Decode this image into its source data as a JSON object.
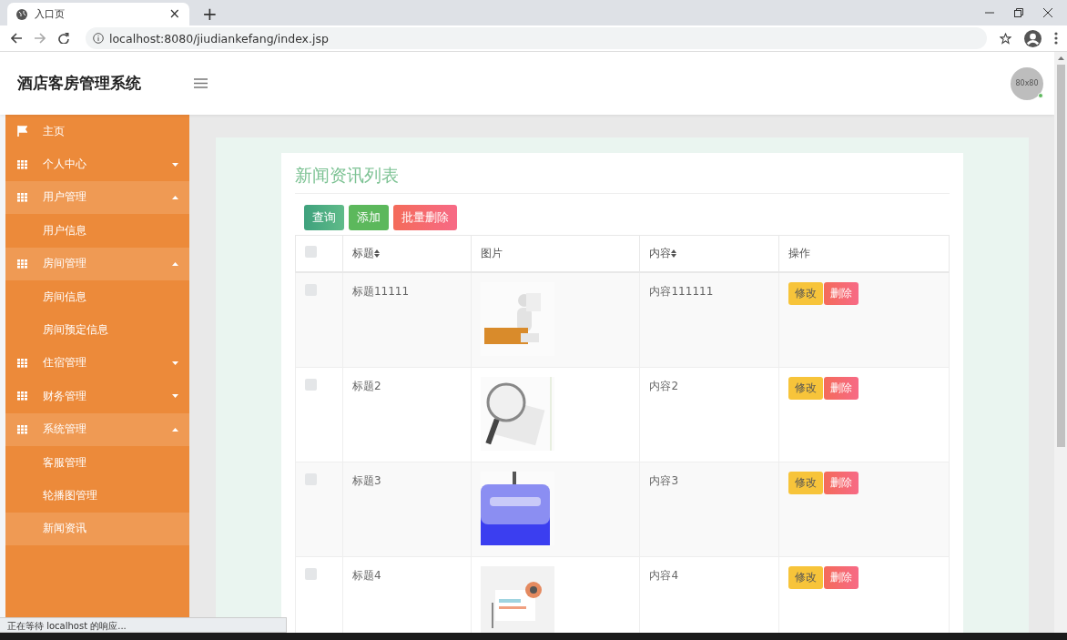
{
  "browser": {
    "tab": {
      "title": "入口页",
      "close": "×"
    },
    "new_tab": "+",
    "url": "localhost:8080/jiudiankefang/index.jsp"
  },
  "header": {
    "title": "酒店客房管理系统",
    "avatar": {
      "text": "80x80",
      "online": true
    }
  },
  "sidebar": {
    "items": [
      {
        "label": "主页",
        "kind": "link",
        "selected": false
      },
      {
        "label": "个人中心",
        "kind": "group",
        "expanded": false
      },
      {
        "label": "用户管理",
        "kind": "group",
        "expanded": true,
        "children": [
          {
            "label": "用户信息",
            "selected": false
          }
        ]
      },
      {
        "label": "房间管理",
        "kind": "group",
        "expanded": true,
        "children": [
          {
            "label": "房间信息",
            "selected": false
          },
          {
            "label": "房间预定信息",
            "selected": false
          }
        ]
      },
      {
        "label": "住宿管理",
        "kind": "group",
        "expanded": false
      },
      {
        "label": "财务管理",
        "kind": "group",
        "expanded": false
      },
      {
        "label": "系统管理",
        "kind": "group",
        "expanded": true,
        "children": [
          {
            "label": "客服管理",
            "selected": false
          },
          {
            "label": "轮播图管理",
            "selected": false
          },
          {
            "label": "新闻资讯",
            "selected": true
          }
        ]
      }
    ]
  },
  "panel": {
    "title": "新闻资讯列表",
    "buttons": [
      {
        "label": "查询",
        "kind": "search"
      },
      {
        "label": "添加",
        "kind": "add"
      },
      {
        "label": "批量删除",
        "kind": "delete"
      }
    ],
    "table": {
      "select_all": {
        "checked": false
      },
      "columns": [
        {
          "label": "标题",
          "sortable": true
        },
        {
          "label": "图片",
          "sortable": false
        },
        {
          "label": "内容",
          "sortable": true
        },
        {
          "label": "操作",
          "sortable": false
        }
      ],
      "rows": [
        {
          "checked": false,
          "title": "标题11111",
          "picture": {
            "kind": "picture"
          },
          "content": "内容111111",
          "actions": [
            {
              "label": "修改",
              "kind": "edit"
            },
            {
              "label": "删除",
              "kind": "delete"
            }
          ]
        },
        {
          "checked": false,
          "title": "标题2",
          "picture": {
            "kind": "picture"
          },
          "content": "内容2",
          "actions": [
            {
              "label": "修改",
              "kind": "edit"
            },
            {
              "label": "删除",
              "kind": "delete"
            }
          ]
        },
        {
          "checked": false,
          "title": "标题3",
          "picture": {
            "kind": "picture"
          },
          "content": "内容3",
          "actions": [
            {
              "label": "修改",
              "kind": "edit"
            },
            {
              "label": "删除",
              "kind": "delete"
            }
          ]
        },
        {
          "checked": false,
          "title": "标题4",
          "picture": {
            "kind": "picture"
          },
          "content": "内容4",
          "actions": [
            {
              "label": "修改",
              "kind": "edit"
            },
            {
              "label": "删除",
              "kind": "delete"
            }
          ]
        }
      ]
    }
  },
  "status_bar": {
    "text": "正在等待 localhost 的响应..."
  }
}
